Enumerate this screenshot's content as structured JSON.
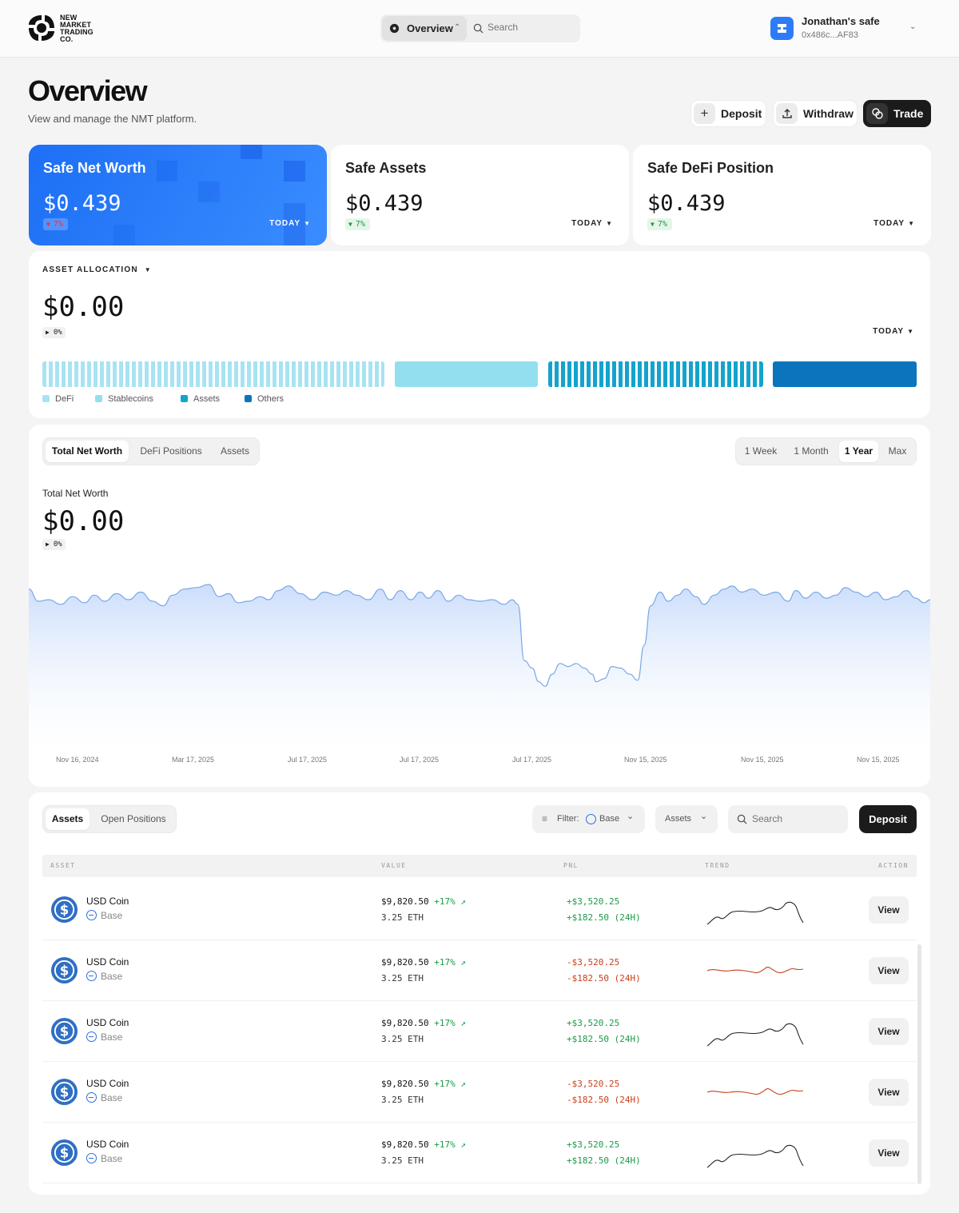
{
  "header": {
    "logo_lines": [
      "NEW",
      "MARKET",
      "TRADING",
      "CO."
    ],
    "nav_label": "Overview",
    "search_placeholder": "Search",
    "account_name": "Jonathan's safe",
    "account_address": "0x486c...AF83"
  },
  "page": {
    "title": "Overview",
    "subtitle": "View and manage the NMT platform."
  },
  "actions": {
    "deposit": "Deposit",
    "withdraw": "Withdraw",
    "trade": "Trade"
  },
  "stats": [
    {
      "title": "Safe Net Worth",
      "value": "$0.439",
      "change": "7%",
      "period": "TODAY"
    },
    {
      "title": "Safe Assets",
      "value": "$0.439",
      "change": "7%",
      "period": "TODAY"
    },
    {
      "title": "Safe DeFi Position",
      "value": "$0.439",
      "change": "7%",
      "period": "TODAY"
    }
  ],
  "allocation": {
    "header": "ASSET ALLOCATION",
    "value": "$0.00",
    "change": "0%",
    "period": "TODAY",
    "legend": [
      {
        "label": "DeFi",
        "color": "#a8e3f3"
      },
      {
        "label": "Stablecoins",
        "color": "#93dff0"
      },
      {
        "label": "Assets",
        "color": "#14a3cc"
      },
      {
        "label": "Others",
        "color": "#0a75bd"
      }
    ]
  },
  "chart": {
    "tabs": [
      "Total Net Worth",
      "DeFi Positions",
      "Assets"
    ],
    "active_tab": "Total Net Worth",
    "ranges": [
      "1 Week",
      "1 Month",
      "1 Year",
      "Max"
    ],
    "active_range": "1 Year",
    "label": "Total Net Worth",
    "value": "$0.00",
    "change": "0%",
    "x_ticks": [
      "Nov 16, 2024",
      "Mar 17, 2025",
      "Jul 17, 2025",
      "Jul 17, 2025",
      "Jul 17, 2025",
      "Nov 15, 2025",
      "Nov 15, 2025",
      "Nov 15, 2025"
    ],
    "color": "#7aa7e8"
  },
  "table": {
    "tabs": [
      "Assets",
      "Open Positions"
    ],
    "active_tab": "Assets",
    "filter_label": "Filter:",
    "filter_value": "Base",
    "type_filter": "Assets",
    "search_placeholder": "Search",
    "deposit_label": "Deposit",
    "columns": [
      "ASSET",
      "VALUE",
      "PNL",
      "TREND",
      "ACTION"
    ],
    "rows": [
      {
        "name": "USD Coin",
        "network": "Base",
        "value": "$9,820.50",
        "value_change": "+17%",
        "amount": "3.25 ETH",
        "pnl": "+$3,520.25",
        "pnl_24h": "+$182.50 (24H)",
        "trend": "up",
        "action": "View"
      },
      {
        "name": "USD Coin",
        "network": "Base",
        "value": "$9,820.50",
        "value_change": "+17%",
        "amount": "3.25 ETH",
        "pnl": "-$3,520.25",
        "pnl_24h": "-$182.50 (24H)",
        "trend": "down",
        "action": "View"
      },
      {
        "name": "USD Coin",
        "network": "Base",
        "value": "$9,820.50",
        "value_change": "+17%",
        "amount": "3.25 ETH",
        "pnl": "+$3,520.25",
        "pnl_24h": "+$182.50 (24H)",
        "trend": "up",
        "action": "View"
      },
      {
        "name": "USD Coin",
        "network": "Base",
        "value": "$9,820.50",
        "value_change": "+17%",
        "amount": "3.25 ETH",
        "pnl": "-$3,520.25",
        "pnl_24h": "-$182.50 (24H)",
        "trend": "down",
        "action": "View"
      },
      {
        "name": "USD Coin",
        "network": "Base",
        "value": "$9,820.50",
        "value_change": "+17%",
        "amount": "3.25 ETH",
        "pnl": "+$3,520.25",
        "pnl_24h": "+$182.50 (24H)",
        "trend": "up",
        "action": "View"
      }
    ]
  }
}
